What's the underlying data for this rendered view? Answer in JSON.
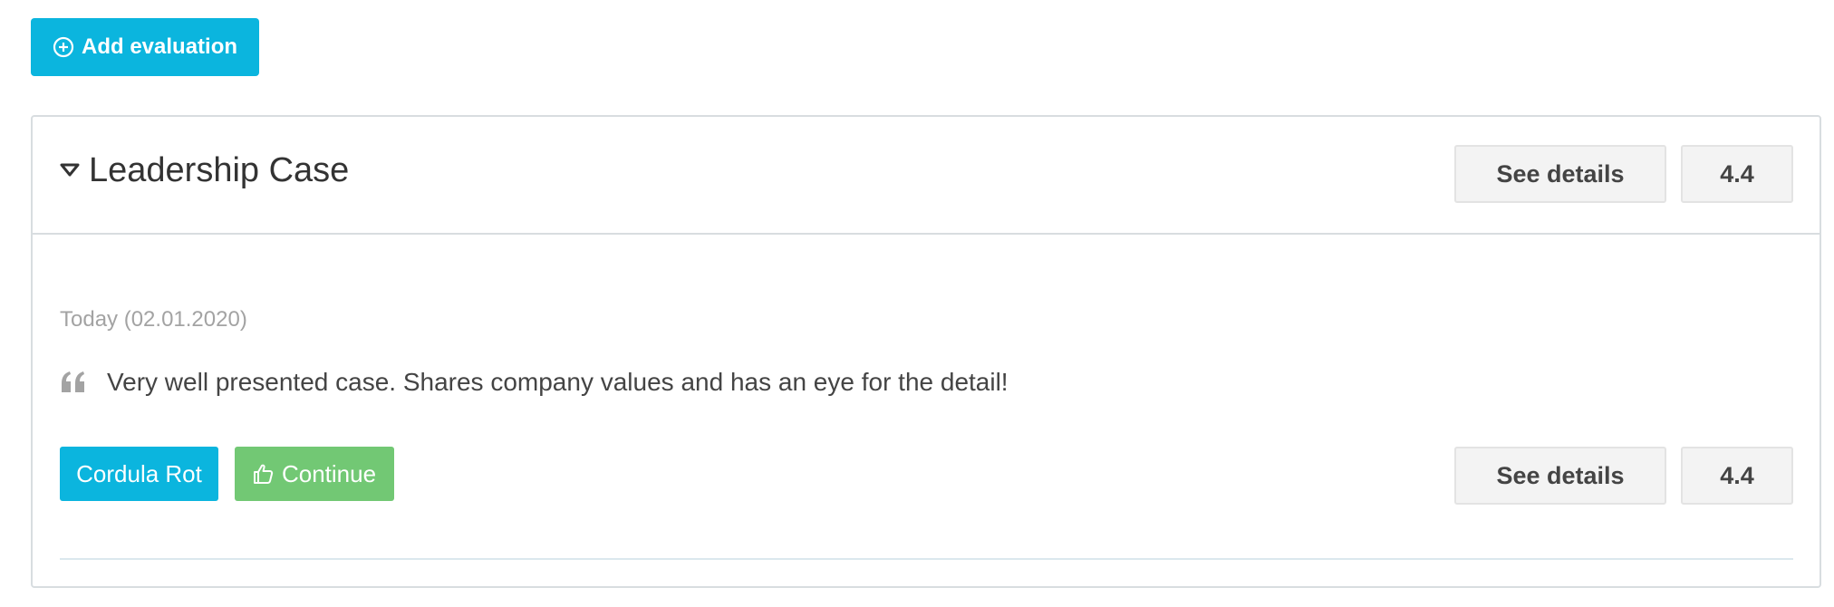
{
  "toolbar": {
    "add_label": "Add evaluation"
  },
  "card": {
    "title": "Leadership Case",
    "see_details_label": "See details",
    "score": "4.4",
    "evaluation": {
      "date": "Today (02.01.2020)",
      "comment": "Very well presented case. Shares company values and has an eye for the detail!",
      "evaluator": "Cordula Rot",
      "decision": "Continue",
      "see_details_label": "See details",
      "score": "4.4"
    }
  },
  "colors": {
    "primary": "#0bb5de",
    "success": "#72c874",
    "border": "#d8dde0",
    "muted_text": "#a3a3a3"
  },
  "icons": {
    "add": "plus-circle-icon",
    "toggle": "caret-down-icon",
    "quote": "quote-left-icon",
    "decision": "thumbs-up-icon"
  }
}
